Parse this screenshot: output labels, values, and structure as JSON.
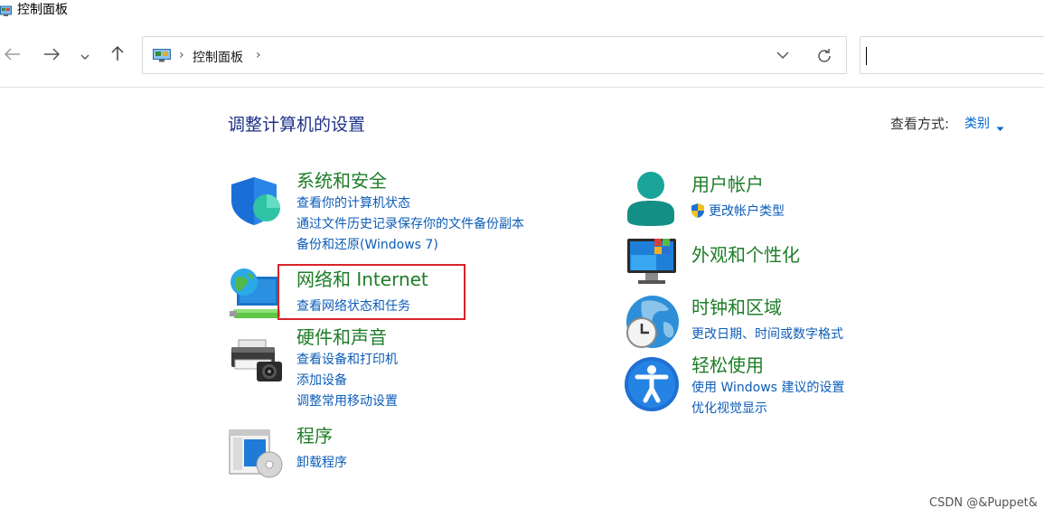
{
  "window": {
    "title": "控制面板"
  },
  "address": {
    "crumbs": [
      "控制面板"
    ],
    "sep": "›"
  },
  "header": {
    "page_title": "调整计算机的设置",
    "view_by_label": "查看方式:",
    "view_by_value": "类别"
  },
  "categories": {
    "system_security": {
      "title": "系统和安全",
      "links": [
        "查看你的计算机状态",
        "通过文件历史记录保存你的文件备份副本",
        "备份和还原(Windows 7)"
      ]
    },
    "network": {
      "title": "网络和 Internet",
      "links": [
        "查看网络状态和任务"
      ]
    },
    "hardware": {
      "title": "硬件和声音",
      "links": [
        "查看设备和打印机",
        "添加设备",
        "调整常用移动设置"
      ]
    },
    "programs": {
      "title": "程序",
      "links": [
        "卸载程序"
      ]
    },
    "user_accounts": {
      "title": "用户帐户",
      "links": [
        "更改帐户类型"
      ]
    },
    "appearance": {
      "title": "外观和个性化",
      "links": []
    },
    "clock_region": {
      "title": "时钟和区域",
      "links": [
        "更改日期、时间或数字格式"
      ]
    },
    "ease_of_access": {
      "title": "轻松使用",
      "links": [
        "使用 Windows 建议的设置",
        "优化视觉显示"
      ]
    }
  },
  "watermark": "CSDN @&Puppet&",
  "colors": {
    "category_title": "#1e7d28",
    "link": "#0d5db8",
    "page_title": "#1e3287",
    "highlight_box": "#d8232a"
  },
  "icons": {
    "nav_back": "arrow-left-icon",
    "nav_forward": "arrow-right-icon",
    "nav_recent": "chevron-down-icon",
    "nav_up": "arrow-up-icon",
    "refresh": "refresh-icon",
    "uac_shield": "uac-shield-icon"
  }
}
